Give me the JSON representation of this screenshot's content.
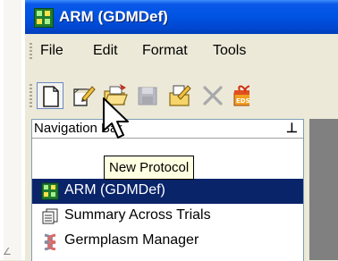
{
  "window": {
    "title": "ARM (GDMDef)",
    "title_icon": "arm-app-icon",
    "titlebar_color": "#0054e3"
  },
  "menu": {
    "items": [
      {
        "label": "File"
      },
      {
        "label": "Edit"
      },
      {
        "label": "Format"
      },
      {
        "label": "Tools"
      }
    ]
  },
  "toolbar": {
    "buttons": [
      {
        "name": "new-protocol",
        "icon": "new-document-icon",
        "state": "pressed"
      },
      {
        "name": "open-edit",
        "icon": "edit-document-icon"
      },
      {
        "name": "open",
        "icon": "open-folder-icon"
      },
      {
        "name": "save",
        "icon": "save-disk-icon",
        "state": "disabled"
      },
      {
        "name": "properties",
        "icon": "edit-folder-icon"
      },
      {
        "name": "delete",
        "icon": "delete-x-icon",
        "state": "disabled"
      },
      {
        "name": "eds",
        "icon": "eds-gift-icon"
      }
    ]
  },
  "tooltip": {
    "text": "New Protocol"
  },
  "navigation_bar": {
    "title": "Navigation Bar",
    "pin_icon": "pin-icon",
    "items": [
      {
        "label": "ARM (GDMDef)",
        "icon": "arm-app-icon",
        "selected": true
      },
      {
        "label": "Summary Across Trials",
        "icon": "summary-table-icon",
        "selected": false
      },
      {
        "label": "Germplasm Manager",
        "icon": "germplasm-icon",
        "selected": false
      }
    ]
  },
  "colors": {
    "selection": "#0a246a",
    "tooltip_bg": "#ffffe1",
    "chrome": "#ece9d8"
  }
}
